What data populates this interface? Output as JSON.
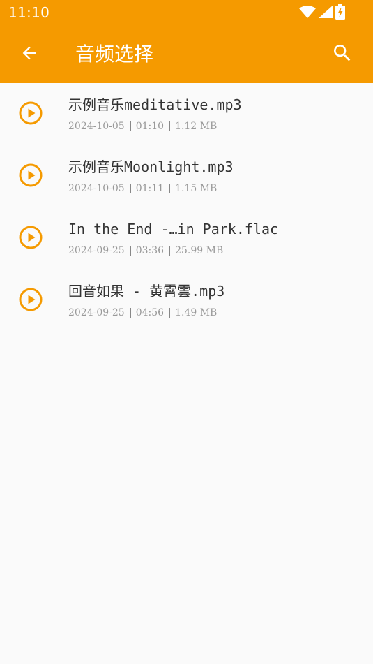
{
  "status_bar": {
    "time": "11:10",
    "icons": [
      "wifi-icon",
      "cell-signal-icon",
      "battery-charging-icon"
    ]
  },
  "app_bar": {
    "title": "音频选择",
    "back_icon": "arrow-left-icon",
    "search_icon": "search-icon",
    "color": "#f59a00"
  },
  "files": [
    {
      "name": "示例音乐meditative.mp3",
      "date": "2024-10-05",
      "duration": "01:10",
      "size": "1.12 MB"
    },
    {
      "name": "示例音乐Moonlight.mp3",
      "date": "2024-10-05",
      "duration": "01:11",
      "size": "1.15 MB"
    },
    {
      "name": "In the End -…in Park.flac",
      "date": "2024-09-25",
      "duration": "03:36",
      "size": "25.99 MB"
    },
    {
      "name": "回音如果 - 黄霄雲.mp3",
      "date": "2024-09-25",
      "duration": "04:56",
      "size": "1.49 MB"
    }
  ],
  "colors": {
    "accent": "#f59a00",
    "background": "#fafafa",
    "title_text": "#333333",
    "meta_text": "#999999"
  }
}
